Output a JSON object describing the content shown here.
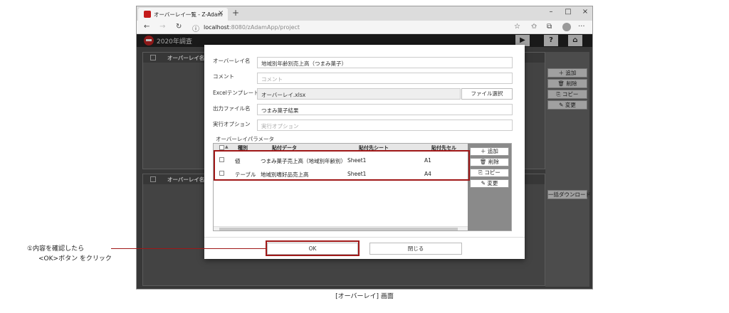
{
  "browser": {
    "tab_title": "オーバーレイ一覧 - Z-Adam",
    "tab_close": "×",
    "new_tab": "+",
    "win_min": "–",
    "win_max": "□",
    "win_close": "×",
    "back": "←",
    "forward": "→",
    "reload": "↻",
    "info": "ⓘ",
    "url_host": "localhost",
    "url_path": ":8080/zAdamApp/project",
    "star": "☆",
    "favorites": "✩",
    "collections": "⧉",
    "more": "···"
  },
  "app": {
    "title": "2020年調査",
    "run_icon": "▶",
    "help_icon": "?",
    "home_icon": "⌂",
    "panel_header": "オーバーレイ名",
    "side_buttons": [
      "＋ 追加",
      "🗑 削除",
      "⎘ コピー",
      "✎ 変更"
    ],
    "bulk_download": "一括ダウンロード"
  },
  "dialog": {
    "fields": {
      "overlay_name_label": "オーバーレイ名",
      "overlay_name_value": "地域別年齢別売上高（つまみ菓子）",
      "comment_label": "コメント",
      "comment_placeholder": "コメント",
      "template_label": "Excelテンプレート",
      "template_value": "オーバーレイ.xlsx",
      "file_select": "ファイル選択",
      "output_label": "出力ファイル名",
      "output_value": "つまみ菓子結果",
      "option_label": "実行オプション",
      "option_placeholder": "実行オプション"
    },
    "params": {
      "section_label": "オーバーレイパラメータ",
      "sort_icon": "▲",
      "headers": [
        "種別",
        "貼付データ",
        "貼付先シート",
        "貼付先セル"
      ],
      "rows": [
        {
          "type": "値",
          "data": "つまみ菓子売上高（地域別年齢別）",
          "sheet": "Sheet1",
          "cell": "A1"
        },
        {
          "type": "テーブル",
          "data": "地域別嗜好品売上高",
          "sheet": "Sheet1",
          "cell": "A4"
        }
      ],
      "buttons": [
        "＋ 追加",
        "🗑 削除",
        "⎘ コピー",
        "✎ 変更"
      ]
    },
    "ok": "OK",
    "close": "閉じる"
  },
  "callout": {
    "line1": "①内容を確認したら",
    "line2": "<OK>ボタン をクリック"
  },
  "caption": "[オーバーレイ] 画面",
  "colors": {
    "highlight": "#a01818",
    "app_bg": "#4b4b4b",
    "header_bg": "#222222"
  }
}
